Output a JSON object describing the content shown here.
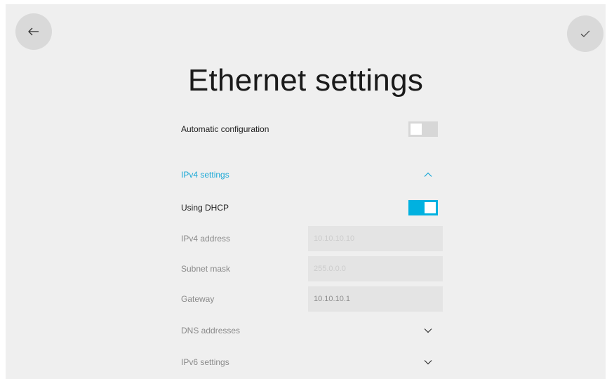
{
  "header": {
    "title": "Ethernet settings",
    "back_icon": "arrow-left-icon",
    "confirm_icon": "checkmark-icon"
  },
  "settings": {
    "automatic_configuration": {
      "label": "Automatic configuration",
      "enabled": false
    },
    "ipv4_section": {
      "label": "IPv4 settings",
      "expanded": true
    },
    "using_dhcp": {
      "label": "Using DHCP",
      "enabled": true
    },
    "ipv4_address": {
      "label": "IPv4 address",
      "value": "10.10.10.10"
    },
    "subnet_mask": {
      "label": "Subnet mask",
      "value": "255.0.0.0"
    },
    "gateway": {
      "label": "Gateway",
      "value": "10.10.10.1"
    },
    "dns_section": {
      "label": "DNS addresses",
      "expanded": false
    },
    "ipv6_section": {
      "label": "IPv6 settings",
      "expanded": false
    }
  },
  "colors": {
    "accent": "#00b1e0",
    "background": "#efefef",
    "toggle_off": "#d7d7d7",
    "field_bg": "#e4e4e4"
  }
}
